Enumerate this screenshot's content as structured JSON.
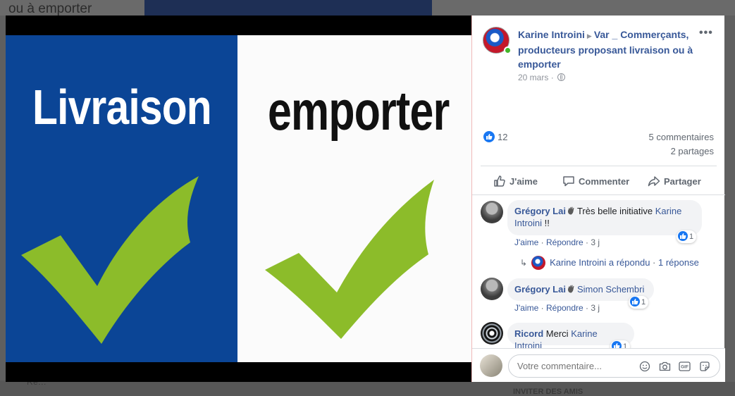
{
  "background": {
    "title_fragment": "ou à emporter",
    "bottom_fragment": "Ré...",
    "invite_label": "INVITER DES AMIS"
  },
  "photo": {
    "left_word": "Livraison",
    "right_word": "emporter",
    "colors": {
      "left_bg": "#0b4596",
      "right_bg": "#fbfbfb",
      "check": "#8cbc2a"
    }
  },
  "post": {
    "author": "Karine Introini",
    "group": "Var _ Commerçants, producteurs proposant livraison ou à emporter",
    "date": "20 mars",
    "more_label": "•••",
    "likes": "12",
    "comments_count": "5 commentaires",
    "shares_count": "2 partages",
    "actions": {
      "like": "J'aime",
      "comment": "Commenter",
      "share": "Partager"
    }
  },
  "comments": [
    {
      "author": "Grégory Lai",
      "text": "Très belle initiative ",
      "mention": "Karine Introini",
      "suffix": " !!",
      "likes": "1",
      "meta": {
        "like": "J'aime",
        "reply": "Répondre",
        "age": "3 j"
      },
      "reply_summary": {
        "text": "Karine Introini a répondu",
        "count": "1 réponse"
      }
    },
    {
      "author": "Grégory Lai",
      "mention": "Simon Schembri",
      "likes": "1",
      "meta": {
        "like": "J'aime",
        "reply": "Répondre",
        "age": "3 j"
      }
    },
    {
      "author": "Ricord",
      "text": "Merci ",
      "mention": "Karine Introini",
      "likes": "1"
    }
  ],
  "composer": {
    "placeholder": "Votre commentaire..."
  },
  "colors": {
    "link": "#385898",
    "muted": "#606770",
    "like_blue": "#1877f2",
    "online": "#42b72a"
  }
}
